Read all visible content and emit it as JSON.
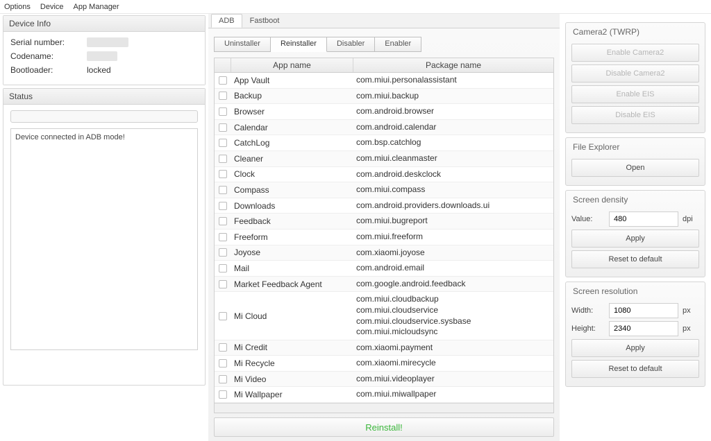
{
  "menu": {
    "options": "Options",
    "device": "Device",
    "app_manager": "App Manager"
  },
  "device_info": {
    "title": "Device Info",
    "serial_label": "Serial number:",
    "codename_label": "Codename:",
    "bootloader_label": "Bootloader:",
    "bootloader_value": "locked"
  },
  "status": {
    "title": "Status",
    "log": "Device connected in ADB mode!"
  },
  "outer_tabs": {
    "adb": "ADB",
    "fastboot": "Fastboot"
  },
  "inner_tabs": {
    "uninstaller": "Uninstaller",
    "reinstaller": "Reinstaller",
    "disabler": "Disabler",
    "enabler": "Enabler"
  },
  "table": {
    "th_app": "App name",
    "th_pkg": "Package name",
    "rows": [
      {
        "name": "App Vault",
        "pkg": "com.miui.personalassistant"
      },
      {
        "name": "Backup",
        "pkg": "com.miui.backup"
      },
      {
        "name": "Browser",
        "pkg": "com.android.browser"
      },
      {
        "name": "Calendar",
        "pkg": "com.android.calendar"
      },
      {
        "name": "CatchLog",
        "pkg": "com.bsp.catchlog"
      },
      {
        "name": "Cleaner",
        "pkg": "com.miui.cleanmaster"
      },
      {
        "name": "Clock",
        "pkg": "com.android.deskclock"
      },
      {
        "name": "Compass",
        "pkg": "com.miui.compass"
      },
      {
        "name": "Downloads",
        "pkg": "com.android.providers.downloads.ui"
      },
      {
        "name": "Feedback",
        "pkg": "com.miui.bugreport"
      },
      {
        "name": "Freeform",
        "pkg": "com.miui.freeform"
      },
      {
        "name": "Joyose",
        "pkg": "com.xiaomi.joyose"
      },
      {
        "name": "Mail",
        "pkg": "com.android.email"
      },
      {
        "name": "Market Feedback Agent",
        "pkg": "com.google.android.feedback"
      },
      {
        "name": "Mi Cloud",
        "pkg": "com.miui.cloudbackup\ncom.miui.cloudservice\ncom.miui.cloudservice.sysbase\ncom.miui.micloudsync"
      },
      {
        "name": "Mi Credit",
        "pkg": "com.xiaomi.payment"
      },
      {
        "name": "Mi Recycle",
        "pkg": "com.xiaomi.mirecycle"
      },
      {
        "name": "Mi Video",
        "pkg": "com.miui.videoplayer"
      },
      {
        "name": "Mi Wallpaper",
        "pkg": "com.miui.miwallpaper"
      }
    ]
  },
  "reinstall_label": "Reinstall!",
  "camera2": {
    "title": "Camera2 (TWRP)",
    "enable_cam": "Enable Camera2",
    "disable_cam": "Disable Camera2",
    "enable_eis": "Enable EIS",
    "disable_eis": "Disable EIS"
  },
  "explorer": {
    "title": "File Explorer",
    "open": "Open"
  },
  "density": {
    "title": "Screen density",
    "value_label": "Value:",
    "value": "480",
    "unit": "dpi",
    "apply": "Apply",
    "reset": "Reset to default"
  },
  "resolution": {
    "title": "Screen resolution",
    "width_label": "Width:",
    "width": "1080",
    "height_label": "Height:",
    "height": "2340",
    "unit": "px",
    "apply": "Apply",
    "reset": "Reset to default"
  }
}
